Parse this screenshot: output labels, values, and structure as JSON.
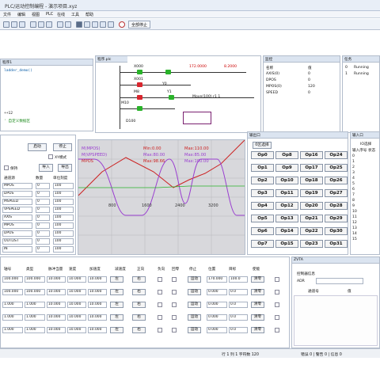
{
  "window": {
    "title": "PLC/运动控制编程 - 演示项目.xyz"
  },
  "menu": [
    "文件",
    "编辑",
    "视图",
    "PLC",
    "在线",
    "工具",
    "帮助"
  ],
  "toolbar": {
    "stop_label": "全部停止"
  },
  "code": {
    "header": "程序1",
    "lines": [
      {
        "text": "ladder_demo()",
        "color": "#0b5ea8"
      },
      {
        "text": "",
        "color": "#111"
      },
      {
        "text": "",
        "color": "#111"
      },
      {
        "text": "",
        "color": "#111"
      },
      {
        "text": "",
        "color": "#111"
      },
      {
        "text": "",
        "color": "#111"
      },
      {
        "text": "++12",
        "color": "#111"
      },
      {
        "text": "' 自定义数据区",
        "color": "#1e8b1e"
      }
    ]
  },
  "ladder": {
    "tab": "程序.plc",
    "top_value_1": "172.0000",
    "top_value_2": "8.2000",
    "r1_label": "X000",
    "r2_label": "X001",
    "r3_label": "M8",
    "r4_label": "M10",
    "coil_1": "Y0",
    "coil_2": "Y1",
    "instr": "Move(100) r1 1",
    "reg": "D100"
  },
  "watch": {
    "header": "监控",
    "cols": [
      "名称",
      "值"
    ],
    "rows": [
      {
        "name": "AXIS(0)",
        "value": "0"
      },
      {
        "name": "DPOS",
        "value": "0"
      },
      {
        "name": "MPOS(0)",
        "value": "120"
      },
      {
        "name": "SPEED",
        "value": "0"
      }
    ]
  },
  "tasks": {
    "header": "任务",
    "rows": [
      {
        "id": "0",
        "state": "Running"
      },
      {
        "id": "1",
        "state": "Running"
      }
    ]
  },
  "scope": {
    "start_label": "启动",
    "stop_label": "停止",
    "xy_label": "XY模式",
    "import_label": "导入",
    "export_label": "导出",
    "hold_label": "保持",
    "col_source": "通道源",
    "col_num": "数量",
    "col_scale": "单位刻度",
    "channels": [
      {
        "name": "MPOS",
        "num": "0",
        "scale": "100"
      },
      {
        "name": "DPOS",
        "num": "0",
        "scale": "100"
      },
      {
        "name": "MSPEED",
        "num": "0",
        "scale": "100"
      },
      {
        "name": "VPSPEED",
        "num": "0",
        "scale": "100"
      },
      {
        "name": "AXIS",
        "num": "0",
        "scale": "100"
      },
      {
        "name": "MPOS",
        "num": "0",
        "scale": "100"
      },
      {
        "name": "DPOS",
        "num": "0",
        "scale": "100"
      },
      {
        "name": "OUTLIST",
        "num": "0",
        "scale": "100"
      },
      {
        "name": "IN",
        "num": "0",
        "scale": "100"
      }
    ],
    "legend": [
      {
        "text": "M(MPOS)",
        "color": "#9a3fd0"
      },
      {
        "text": "M(VPSPEED)",
        "color": "#9a3fd0"
      },
      {
        "text": "MPOS",
        "color": "#cc2222"
      }
    ],
    "max_labels": [
      {
        "text": "Min:0.00",
        "color": "#cc2222"
      },
      {
        "text": "Max:80.00",
        "color": "#9a3fd0"
      },
      {
        "text": "Max:98.66",
        "color": "#cc2222"
      },
      {
        "text": "Max:110.00",
        "color": "#cc2222"
      },
      {
        "text": "Max:85.00",
        "color": "#9a3fd0"
      },
      {
        "text": "Max:100.00",
        "color": "#9a3fd0"
      }
    ],
    "ticks": [
      "800",
      "1600",
      "2400",
      "3200"
    ]
  },
  "outputs": {
    "header": "输出口",
    "page_label": "0区选择",
    "items": [
      "Op0",
      "Op8",
      "Op16",
      "Op24",
      "Op1",
      "Op9",
      "Op17",
      "Op25",
      "Op2",
      "Op10",
      "Op18",
      "Op26",
      "Op3",
      "Op11",
      "Op19",
      "Op27",
      "Op4",
      "Op12",
      "Op20",
      "Op28",
      "Op5",
      "Op13",
      "Op21",
      "Op29",
      "Op6",
      "Op14",
      "Op22",
      "Op30",
      "Op7",
      "Op15",
      "Op23",
      "Op31"
    ],
    "items_top": [
      "Op32",
      "Op40",
      "Op48",
      "Op56",
      "Op33",
      "Op41",
      "Op49",
      "Op57",
      "Op34",
      "Op42",
      "Op50",
      "Op58",
      "Op35",
      "Op43",
      "Op51",
      "Op59",
      "Op36",
      "Op44",
      "Op52",
      "Op60",
      "Op37",
      "Op45",
      "Op53",
      "Op61",
      "Op38",
      "Op46",
      "Op54",
      "Op62",
      "Op39",
      "Op47",
      "Op55",
      "Op63"
    ]
  },
  "inputs": {
    "header": "输入口",
    "page_label": "IO选择",
    "cols": [
      "输入序号",
      "状态"
    ],
    "numbers": [
      "0",
      "1",
      "2",
      "3",
      "4",
      "5",
      "6",
      "7",
      "8",
      "9",
      "10",
      "11",
      "12",
      "13",
      "14",
      "15"
    ]
  },
  "axes": {
    "cols": [
      "轴号",
      "类型",
      "脉冲当量",
      "速度",
      "加速度",
      "减速度",
      "正向",
      "负向",
      "回零",
      "停止",
      "位置",
      "目标",
      "使能"
    ],
    "rows": [
      {
        "axis": "100.000",
        "units": "100.000",
        "speed": "10.000",
        "accel": "10.000",
        "decel": "10.000",
        "pos": "170.000",
        "tgt": "100.0"
      },
      {
        "axis": "100.000",
        "units": "100.000",
        "speed": "10.000",
        "accel": "10.000",
        "decel": "10.000",
        "pos": "0.000",
        "tgt": "0.0"
      },
      {
        "axis": "1.000",
        "units": "1.000",
        "speed": "10.000",
        "accel": "10.000",
        "decel": "10.000",
        "pos": "0.000",
        "tgt": "0.0"
      },
      {
        "axis": "1.000",
        "units": "1.000",
        "speed": "10.000",
        "accel": "10.000",
        "decel": "10.000",
        "pos": "0.000",
        "tgt": "0.0"
      },
      {
        "axis": "1.000",
        "units": "1.000",
        "speed": "10.000",
        "accel": "10.000",
        "decel": "10.000",
        "pos": "0.000",
        "tgt": "0.0"
      }
    ],
    "btn_fwd": "左",
    "btn_back": "右",
    "btn_run": "运动",
    "btn_zero": "清零"
  },
  "axis_panel": {
    "header": "ZVTA",
    "label": "控制器信息",
    "field": "ADR",
    "col_1": "通道号",
    "col_2": "值"
  },
  "status": {
    "left": "行 1 列 1  字符数 120",
    "middle": "错误 0 | 警告 0 | 信息 0"
  }
}
